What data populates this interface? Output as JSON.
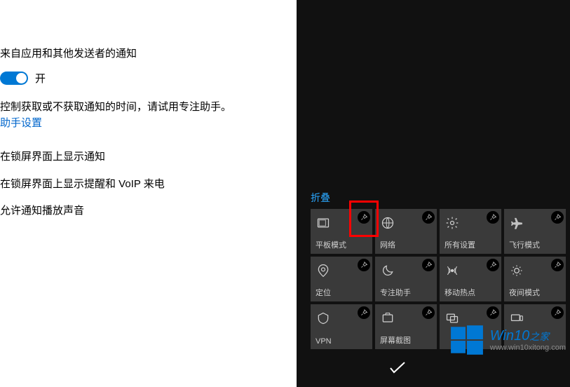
{
  "settings": {
    "notifications_label": "来自应用和其他发送者的通知",
    "toggle_state": "开",
    "focus_hint": "控制获取或不获取通知的时间，请试用专注助手。",
    "focus_link": "助手设置",
    "lock_notify": "在锁屏界面上显示通知",
    "lock_remind": "在锁屏界面上显示提醒和 VoIP 来电",
    "allow_sound": "允许通知播放声音"
  },
  "action_center": {
    "collapse": "折叠",
    "tiles": [
      {
        "label": "平板模式",
        "icon": "tablet"
      },
      {
        "label": "网络",
        "icon": "network"
      },
      {
        "label": "所有设置",
        "icon": "gear"
      },
      {
        "label": "飞行模式",
        "icon": "airplane"
      },
      {
        "label": "定位",
        "icon": "location"
      },
      {
        "label": "专注助手",
        "icon": "moon"
      },
      {
        "label": "移动热点",
        "icon": "hotspot"
      },
      {
        "label": "夜间模式",
        "icon": "night"
      },
      {
        "label": "VPN",
        "icon": "vpn"
      },
      {
        "label": "屏幕截图",
        "icon": "screenshot"
      },
      {
        "label": "",
        "icon": "project"
      },
      {
        "label": "",
        "icon": "connect"
      }
    ]
  },
  "watermark": {
    "title": "Win10",
    "suffix": "之家",
    "url": "www.win10xitong.com"
  }
}
